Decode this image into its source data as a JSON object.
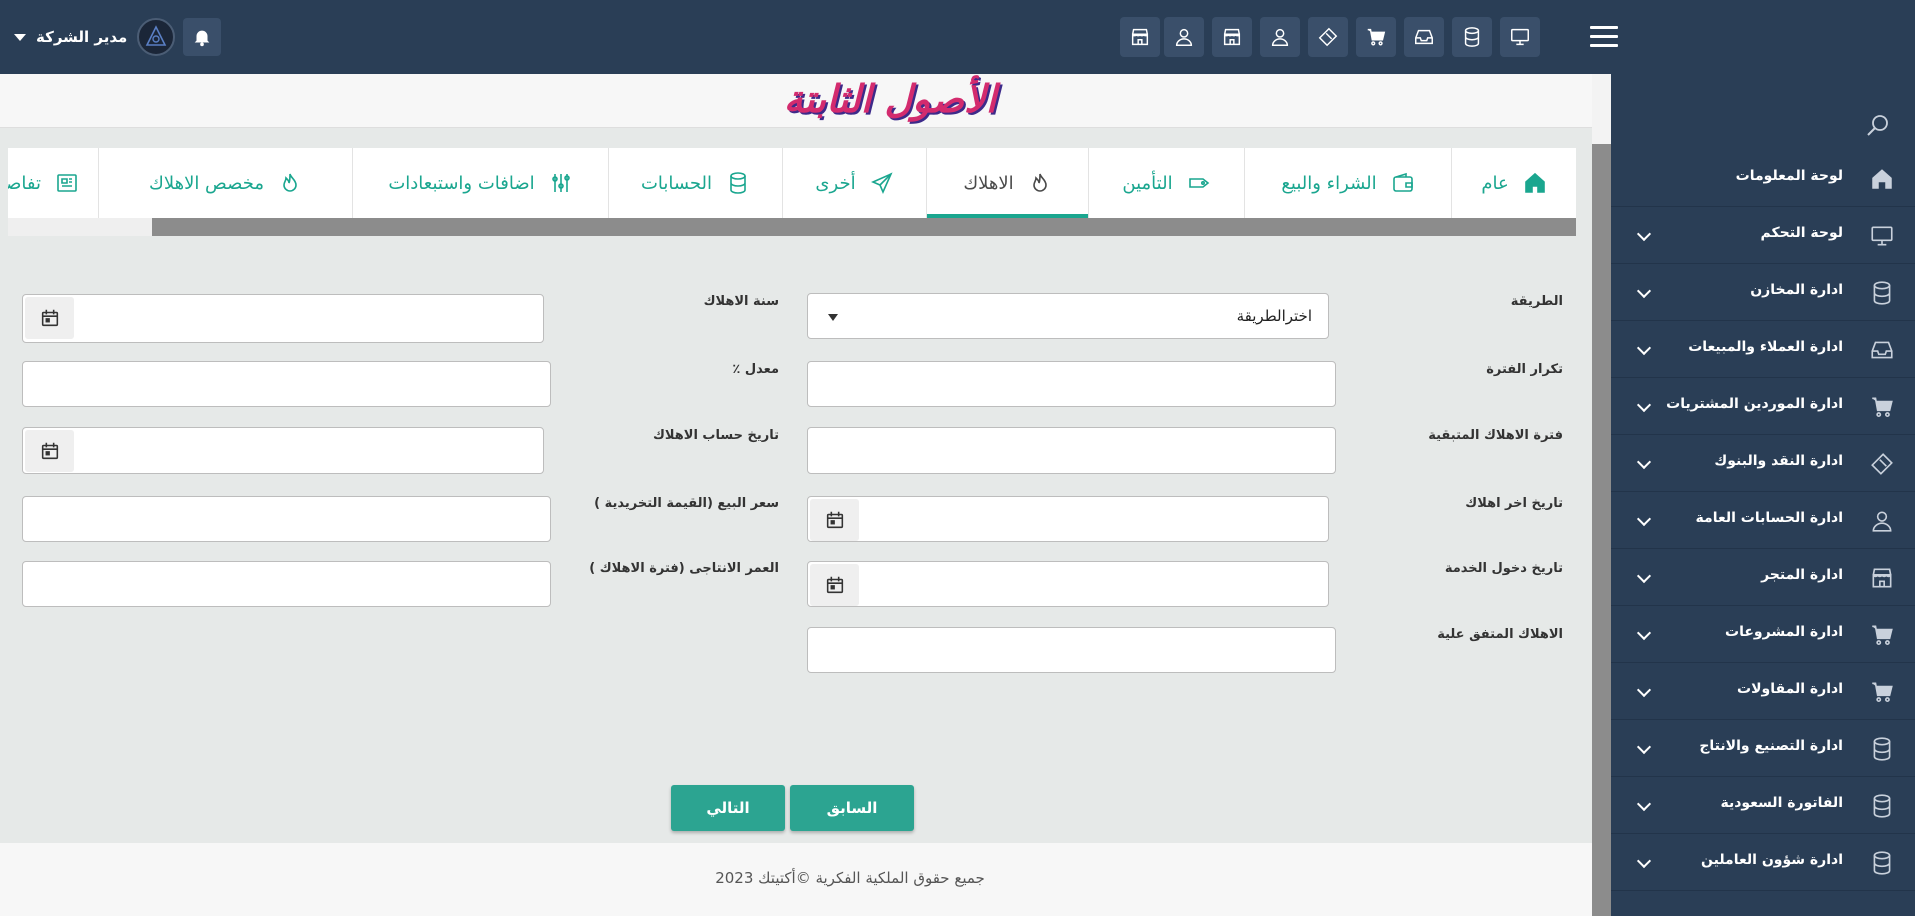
{
  "header": {
    "user_name": "مدير الشركة"
  },
  "page": {
    "title": "الأصول الثابتة"
  },
  "tabs": [
    {
      "label": "عام",
      "icon": "home-icon"
    },
    {
      "label": "الشراء والبيع",
      "icon": "wallet-icon"
    },
    {
      "label": "التأمين",
      "icon": "tag-icon"
    },
    {
      "label": "الاهلاك",
      "icon": "flame-icon",
      "active": true
    },
    {
      "label": "أخرى",
      "icon": "send-icon"
    },
    {
      "label": "الحسابات",
      "icon": "database-icon"
    },
    {
      "label": "اضافات واستبعادات",
      "icon": "sliders-icon"
    },
    {
      "label": "مخصص الاهلاك",
      "icon": "flame-icon"
    },
    {
      "label": "تفاصيل",
      "icon": "newspaper-icon"
    }
  ],
  "form": {
    "method_label": "الطريقة",
    "method_value": "اخترالطريقة",
    "year_label": "سنة الاهلاك",
    "period_repeat_label": "تكرار الفترة",
    "rate_label": "معدل ٪",
    "remaining_label": "فترة الاهلاك المتبقية",
    "calc_date_label": "تاريخ حساب الاهلاك",
    "last_date_label": "تاريخ اخر اهلاك",
    "sale_price_label": "سعر البيع (القيمة التخريدية )",
    "service_date_label": "تاريخ دخول الخدمة",
    "life_label": "العمر الانتاجى (فترة الاهلاك )",
    "agreed_label": "الاهلاك المتفق علية"
  },
  "buttons": {
    "prev": "السابق",
    "next": "التالي"
  },
  "sidebar": {
    "items": [
      {
        "label": "لوحة المعلومات",
        "icon": "home-icon",
        "expandable": false
      },
      {
        "label": "لوحة التحكم",
        "icon": "monitor-icon",
        "expandable": true
      },
      {
        "label": "ادارة المخازن",
        "icon": "database-icon",
        "expandable": true
      },
      {
        "label": "ادارة العملاء والمبيعات",
        "icon": "inbox-icon",
        "expandable": true
      },
      {
        "label": "ادارة الموردين المشتريات",
        "icon": "cart-icon",
        "expandable": true
      },
      {
        "label": "ادارة النقد والبنوك",
        "icon": "ticket-icon",
        "expandable": true
      },
      {
        "label": "ادارة الحسابات العامة",
        "icon": "user-icon",
        "expandable": true
      },
      {
        "label": "ادارة المتجر",
        "icon": "store-icon",
        "expandable": true
      },
      {
        "label": "ادارة المشروعات",
        "icon": "cart-icon",
        "expandable": true
      },
      {
        "label": "ادارة المقاولات",
        "icon": "cart-icon",
        "expandable": true
      },
      {
        "label": "ادارة التصنيع والانتاج",
        "icon": "database-icon",
        "expandable": true
      },
      {
        "label": "الفاتورة السعودية",
        "icon": "database-icon",
        "expandable": true
      },
      {
        "label": "ادارة شؤون العاملين",
        "icon": "database-icon",
        "expandable": true
      }
    ]
  },
  "footer": {
    "text": "جميع حقوق الملكية الفكرية ©أكتيتك 2023"
  }
}
